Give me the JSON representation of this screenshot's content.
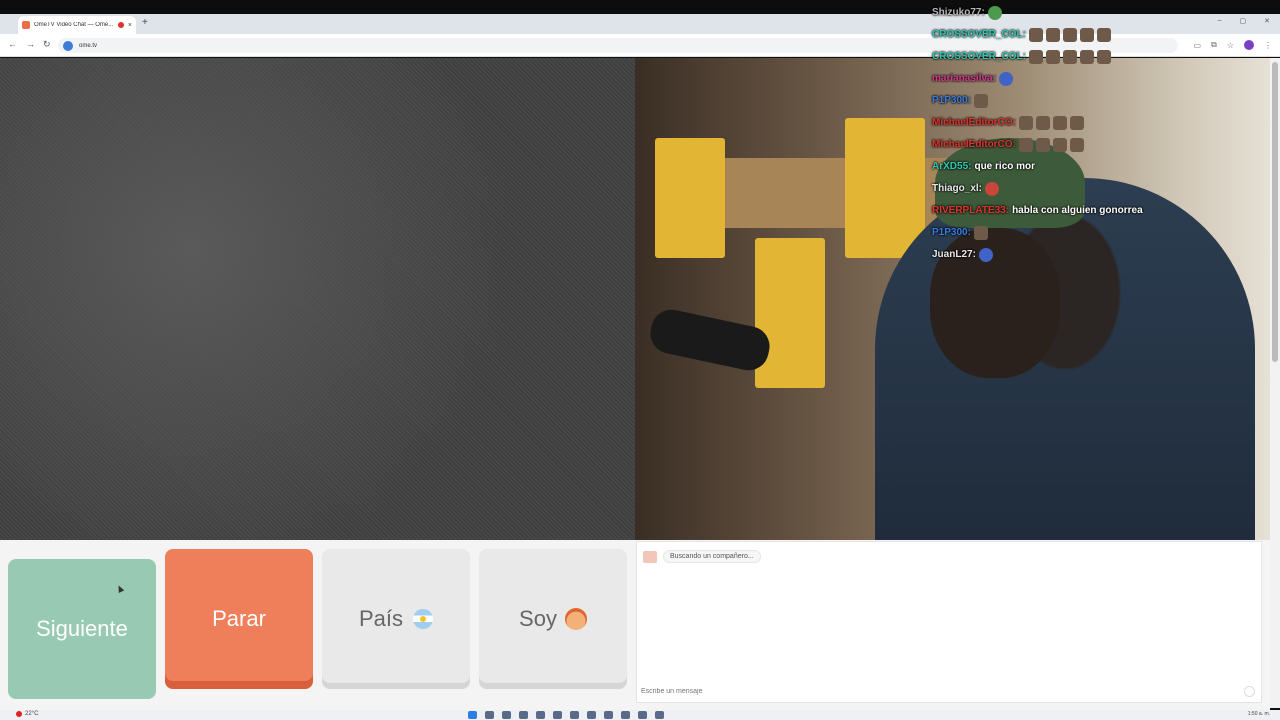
{
  "browser": {
    "tab_title": "OmeTV Video Chat — Ome...",
    "tab_close": "×",
    "new_tab": "+",
    "url": "ome.tv",
    "window_controls": [
      "–",
      "▢",
      "✕"
    ]
  },
  "overlay_chat": [
    {
      "user": "Shizuko77:",
      "color": "#b7b7b7",
      "message": "",
      "emotes": [
        "g"
      ]
    },
    {
      "user": "CROSSOVER_COL:",
      "color": "#2fc7b0",
      "message": "",
      "emotes": [
        "e",
        "e",
        "e",
        "e",
        "e"
      ]
    },
    {
      "user": "CROSSOVER_COL:",
      "color": "#2fc7b0",
      "message": "",
      "emotes": [
        "e",
        "e",
        "e",
        "e",
        "e"
      ]
    },
    {
      "user": "marianasilva:",
      "color": "#d63a8e",
      "message": "",
      "emotes": [
        "b"
      ]
    },
    {
      "user": "P1P300:",
      "color": "#3b7be0",
      "message": "",
      "emotes": [
        "e"
      ]
    },
    {
      "user": "MichaelEditorCO:",
      "color": "#e0342e",
      "message": "",
      "emotes": [
        "e",
        "e",
        "e",
        "e"
      ]
    },
    {
      "user": "MichaelEditorCO:",
      "color": "#e0342e",
      "message": "",
      "emotes": [
        "e",
        "e",
        "e",
        "e"
      ]
    },
    {
      "user": "ArXD55:",
      "color": "#2fc7b0",
      "message": "que rico mor",
      "emotes": []
    },
    {
      "user": "Thiago_xl:",
      "color": "#e8e8e8",
      "message": "",
      "emotes": [
        "r"
      ]
    },
    {
      "user": "RIVERPLATE33:",
      "color": "#e0342e",
      "message": "habla con alguien gonorrea",
      "emotes": []
    },
    {
      "user": "P1P300:",
      "color": "#3b7be0",
      "message": "",
      "emotes": [
        "e"
      ]
    },
    {
      "user": "JuanL27:",
      "color": "#e8e8e8",
      "message": "",
      "emotes": [
        "b"
      ]
    }
  ],
  "controls": {
    "next": "Siguiente",
    "stop": "Parar",
    "country": "País",
    "me": "Soy"
  },
  "chat": {
    "status": "Buscando un compañero...",
    "placeholder": "Escribe un mensaje"
  },
  "taskbar": {
    "weather": "22°C",
    "clock": "1:50 a. m."
  },
  "colors": {
    "next_button": "#97c9b3",
    "stop_button": "#ef7e5a",
    "neutral_button": "#e9e9e9"
  }
}
